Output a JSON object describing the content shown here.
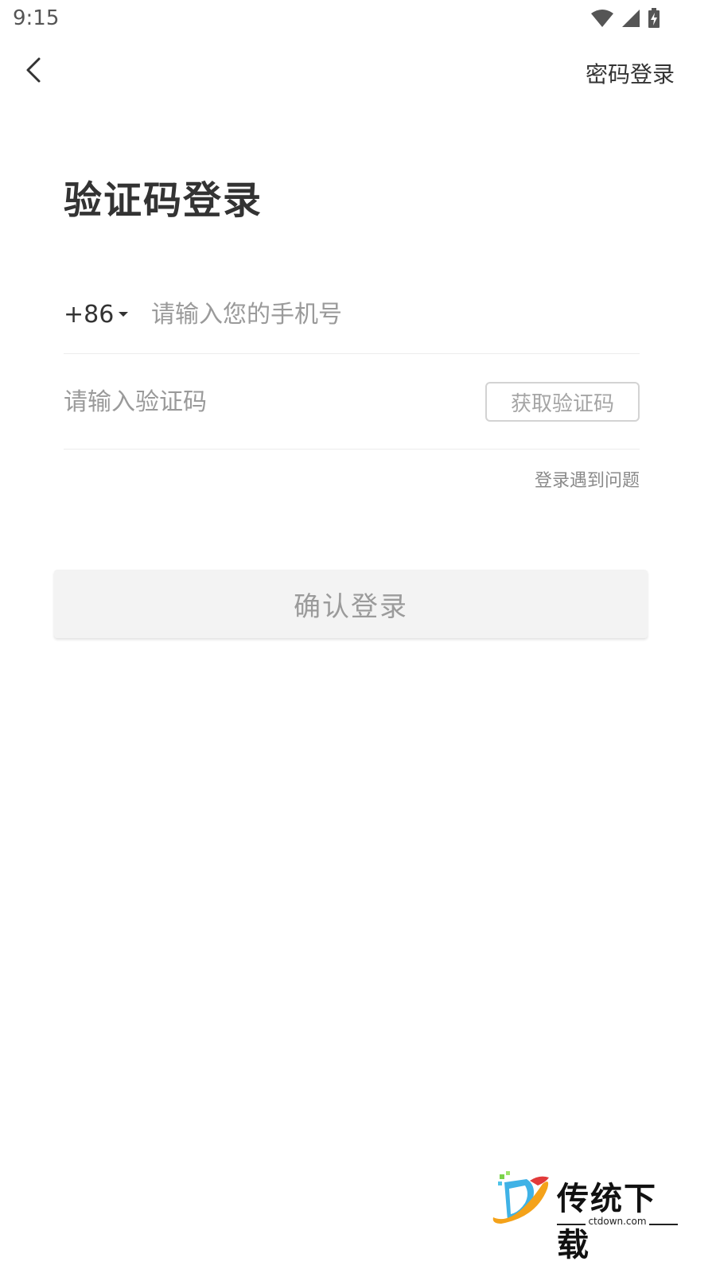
{
  "status_bar": {
    "time": "9:15",
    "icons": [
      "wifi-icon",
      "signal-icon",
      "battery-charging-icon"
    ]
  },
  "nav": {
    "back_icon": "chevron-left-icon",
    "right_link": "密码登录"
  },
  "title": "验证码登录",
  "phone": {
    "country_code": "+86",
    "placeholder": "请输入您的手机号",
    "value": ""
  },
  "code": {
    "placeholder": "请输入验证码",
    "value": "",
    "get_code_label": "获取验证码"
  },
  "help_link": "登录遇到问题",
  "confirm_label": "确认登录",
  "watermark": {
    "brand": "传统下载",
    "domain": "ctdown.com"
  },
  "colors": {
    "text_primary": "#333333",
    "placeholder": "#9a9a9a",
    "button_disabled_bg": "#f3f3f3",
    "button_disabled_text": "#9b9b9b",
    "divider": "#ececec"
  }
}
